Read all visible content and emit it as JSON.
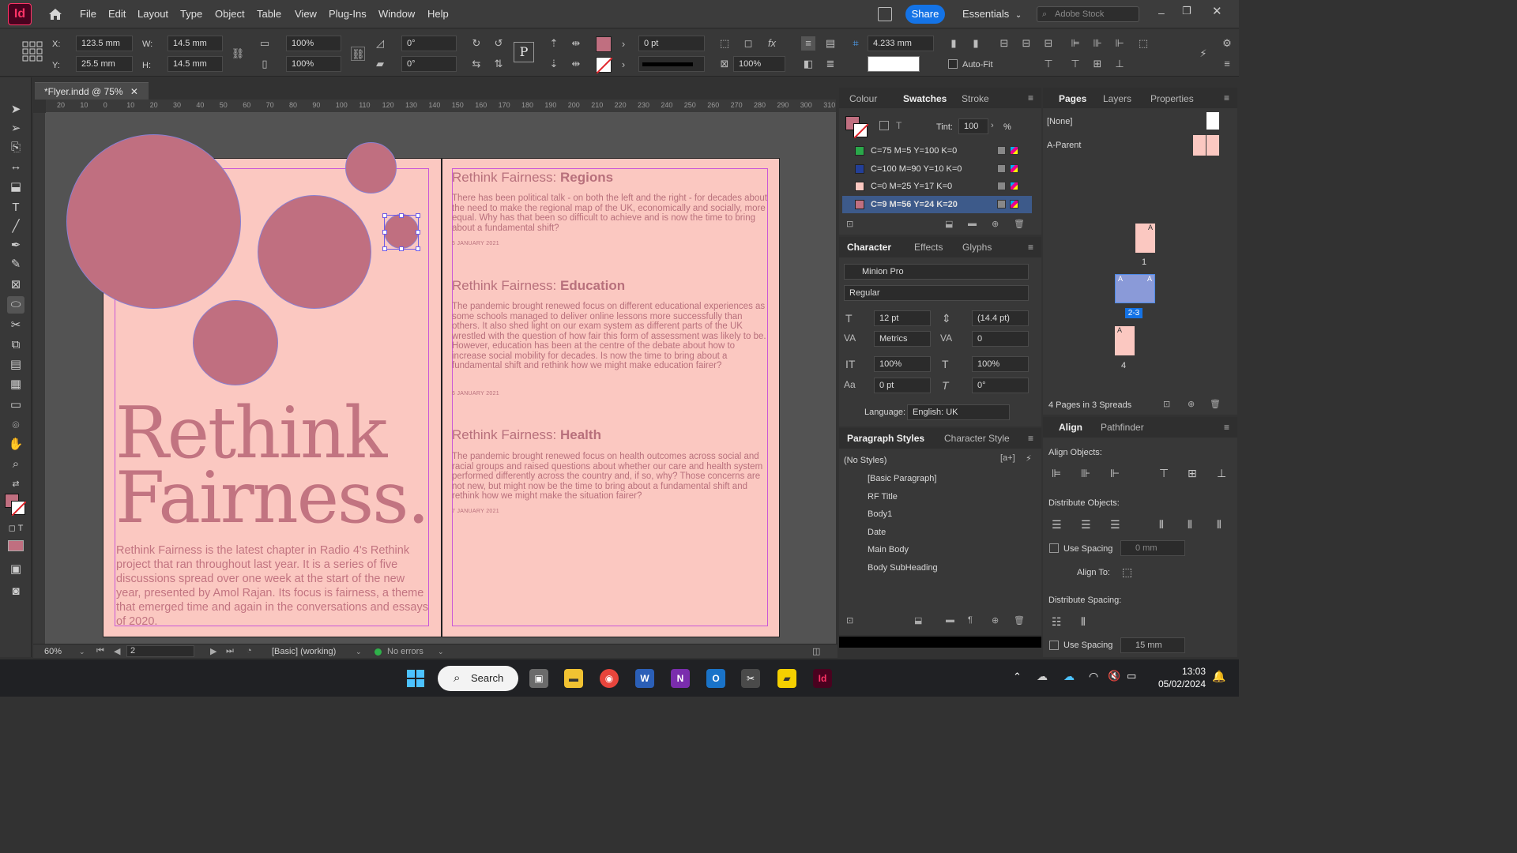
{
  "menubar": {
    "app_logo": "Id",
    "items": [
      "File",
      "Edit",
      "Layout",
      "Type",
      "Object",
      "Table",
      "View",
      "Plug-Ins",
      "Window",
      "Help"
    ],
    "share_label": "Share",
    "workspace": "Essentials",
    "stock_placeholder": "Adobe Stock"
  },
  "control": {
    "x_label": "X:",
    "x_value": "123.5 mm",
    "y_label": "Y:",
    "y_value": "25.5 mm",
    "w_label": "W:",
    "w_value": "14.5 mm",
    "h_label": "H:",
    "h_value": "14.5 mm",
    "scale_x": "100%",
    "scale_y": "100%",
    "rotate": "0°",
    "shear": "0°",
    "stroke_weight": "0 pt",
    "opacity": "100%",
    "offset": "4.233 mm",
    "autofit_label": "Auto-Fit"
  },
  "document": {
    "tab_title": "*Flyer.indd @ 75%",
    "ruler_h": [
      "20",
      "10",
      "0",
      "10",
      "20",
      "30",
      "40",
      "50",
      "60",
      "70",
      "80",
      "90",
      "100",
      "110",
      "120",
      "130",
      "140",
      "150",
      "160",
      "170",
      "180",
      "190",
      "200",
      "210",
      "220",
      "230",
      "240",
      "250",
      "260",
      "270",
      "280",
      "290",
      "300",
      "310"
    ]
  },
  "flyer": {
    "title_line1": "Rethink",
    "title_line2": "Fairness.",
    "intro": "Rethink Fairness is the latest chapter in Radio 4's Rethink project that ran throughout last year. It is a series of five discussions spread over one week at the start of the new year, presented by Amol Rajan. Its focus is fairness, a theme that emerged time and again in the conversations and essays of 2020.",
    "articles": [
      {
        "heading_prefix": "Rethink Fairness: ",
        "heading_bold": "Regions",
        "body": "There has been political talk - on both the left and the right - for decades about the need to make the regional map of the UK, economically and socially, more equal. Why has that been so difficult to achieve and is now the time to bring about a fundamental shift?",
        "date": "5 JANUARY 2021"
      },
      {
        "heading_prefix": "Rethink Fairness: ",
        "heading_bold": "Education",
        "body": "The pandemic brought renewed focus on different educational experiences as some schools managed to deliver online lessons more successfully than others. It also shed light on our exam system as different parts of the UK wrestled with the question of how fair this form of assessment was likely to be. However, education has been at the centre of the debate about how to increase social mobility for decades. Is now the time to bring about a fundamental shift and rethink how we might make education fairer?",
        "date": "6 JANUARY 2021"
      },
      {
        "heading_prefix": "Rethink Fairness: ",
        "heading_bold": "Health",
        "body": "The pandemic brought renewed focus on health outcomes across social and racial groups and raised questions about whether our care and health system performed differently across the country and, if so, why? Those concerns are not new, but might now be the time to bring about a fundamental shift and rethink how we might make the situation fairer?",
        "date": "7 JANUARY 2021"
      }
    ]
  },
  "statusbar": {
    "zoom": "60%",
    "page": "2",
    "style": "[Basic] (working)",
    "errors": "No errors"
  },
  "swatches_panel": {
    "tabs": [
      "Colour",
      "Swatches",
      "Stroke"
    ],
    "tint_label": "Tint:",
    "tint_value": "100",
    "tint_unit": "%",
    "items": [
      {
        "name": "C=75 M=5 Y=100 K=0",
        "color": "#2aa84a"
      },
      {
        "name": "C=100 M=90 Y=10 K=0",
        "color": "#233f98"
      },
      {
        "name": "C=0 M=25 Y=17 K=0",
        "color": "#fbc8c1"
      },
      {
        "name": "C=9 M=56 Y=24 K=20",
        "color": "#c06f80"
      }
    ]
  },
  "character_panel": {
    "tabs": [
      "Character",
      "Effects",
      "Glyphs"
    ],
    "font": "Minion Pro",
    "style": "Regular",
    "size": "12 pt",
    "leading": "(14.4 pt)",
    "kerning": "Metrics",
    "tracking": "0",
    "vscale": "100%",
    "hscale": "100%",
    "baseline": "0 pt",
    "skew": "0°",
    "language_label": "Language:",
    "language": "English: UK"
  },
  "paragraph_panel": {
    "tabs": [
      "Paragraph Styles",
      "Character Style"
    ],
    "current": "(No Styles)",
    "styles": [
      "[Basic Paragraph]",
      "RF Title",
      "Body1",
      "Date",
      "Main Body",
      "Body SubHeading"
    ]
  },
  "pages_panel": {
    "tabs": [
      "Pages",
      "Layers",
      "Properties"
    ],
    "none_label": "[None]",
    "parent_label": "A-Parent",
    "page_labels": [
      "1",
      "2-3",
      "4"
    ],
    "page_master": "A",
    "summary": "4 Pages in 3 Spreads"
  },
  "align_panel": {
    "tabs": [
      "Align",
      "Pathfinder"
    ],
    "align_objects": "Align Objects:",
    "distribute_objects": "Distribute Objects:",
    "use_spacing": "Use Spacing",
    "spacing_value": "0 mm",
    "align_to": "Align To:",
    "distribute_spacing": "Distribute Spacing:",
    "use_spacing2": "Use Spacing",
    "spacing_value2": "15 mm"
  },
  "taskbar": {
    "search_label": "Search",
    "time": "13:03",
    "date": "05/02/2024"
  }
}
